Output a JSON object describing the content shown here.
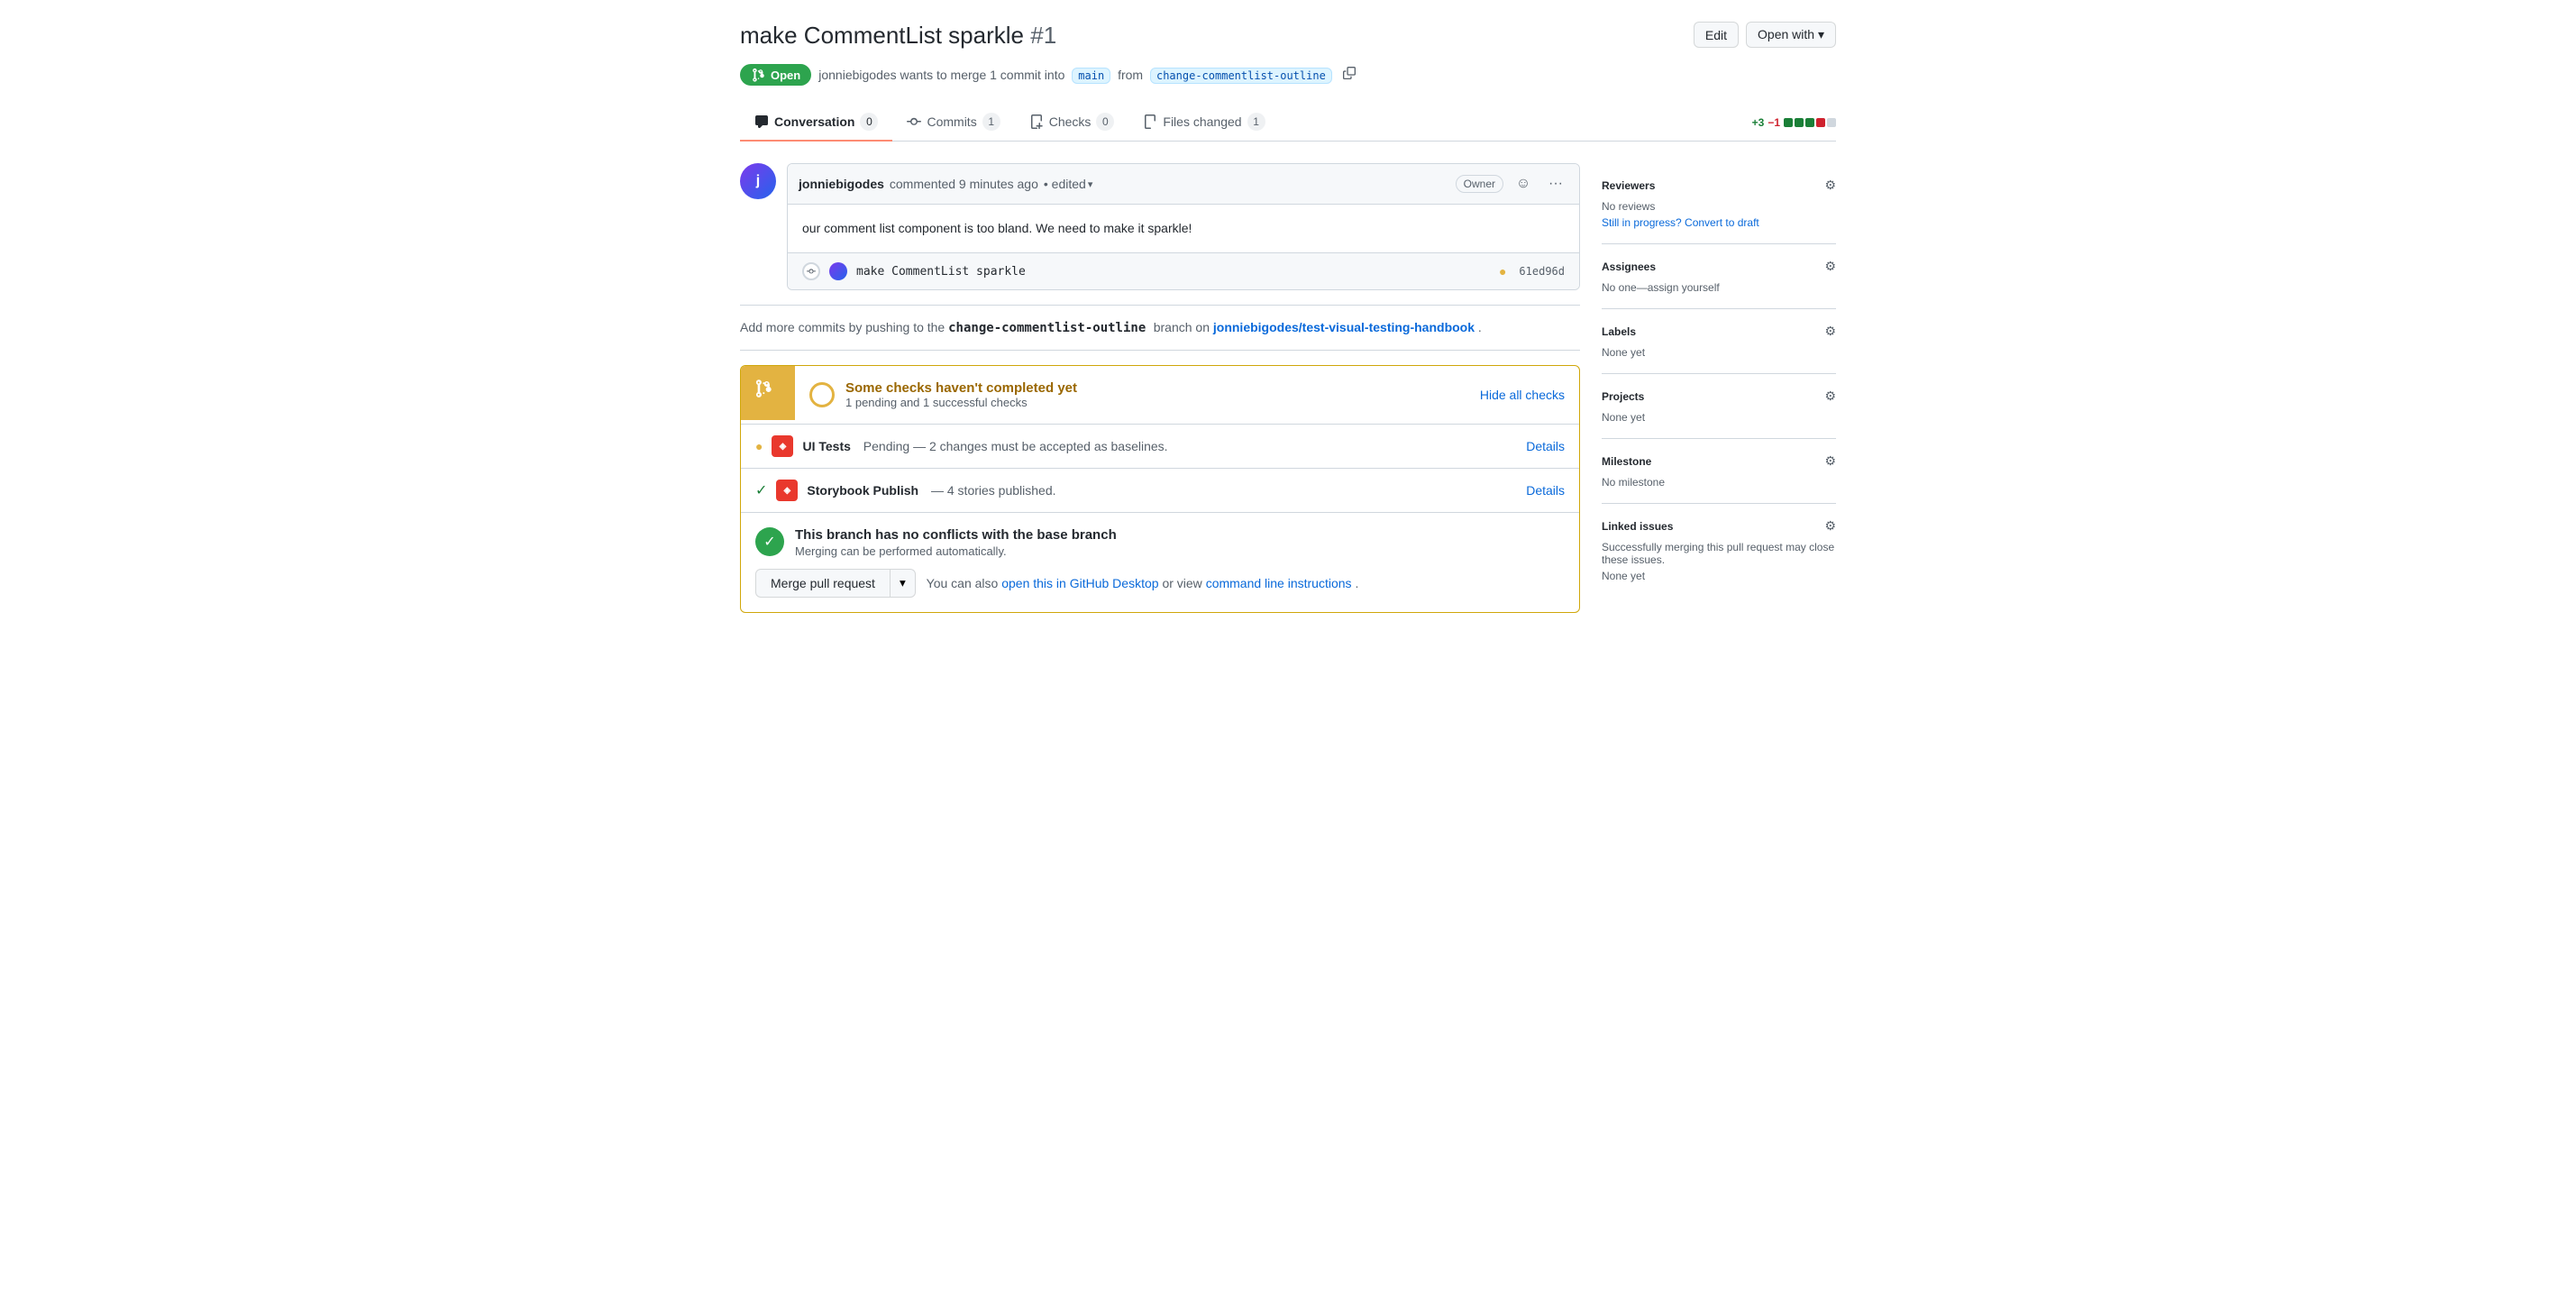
{
  "header": {
    "title": "make CommentList sparkle",
    "pr_number": "#1",
    "edit_label": "Edit",
    "open_with_label": "Open with ▾"
  },
  "status": {
    "badge": "Open",
    "description": "jonniebigodes wants to merge 1 commit into",
    "base_branch": "main",
    "from_text": "from",
    "head_branch": "change-commentlist-outline"
  },
  "tabs": {
    "conversation": {
      "label": "Conversation",
      "count": "0"
    },
    "commits": {
      "label": "Commits",
      "count": "1"
    },
    "checks": {
      "label": "Checks",
      "count": "0"
    },
    "files_changed": {
      "label": "Files changed",
      "count": "1"
    }
  },
  "diff_stats": {
    "additions": "+3",
    "deletions": "−1"
  },
  "comment": {
    "author": "jonniebigodes",
    "time": "commented 9 minutes ago",
    "edited": "• edited",
    "owner_badge": "Owner",
    "body": "our comment list component is too bland. We need to make it sparkle!"
  },
  "commit": {
    "name": "make CommentList sparkle",
    "sha": "61ed96d"
  },
  "push_notice": {
    "text_before": "Add more commits by pushing to the",
    "branch": "change-commentlist-outline",
    "text_middle": "branch on",
    "repo": "jonniebigodes/test-visual-testing-handbook",
    "text_after": "."
  },
  "checks": {
    "title": "Some checks haven't completed yet",
    "subtitle": "1 pending and 1 successful checks",
    "hide_label": "Hide all checks",
    "items": [
      {
        "name": "UI Tests",
        "status_dot": "yellow",
        "description": "Pending — 2 changes must be accepted as baselines.",
        "link": "Details"
      },
      {
        "name": "Storybook Publish",
        "status_dot": "green",
        "description": "— 4 stories published.",
        "link": "Details"
      }
    ]
  },
  "merge": {
    "title": "This branch has no conflicts with the base branch",
    "subtitle": "Merging can be performed automatically.",
    "button": "Merge pull request",
    "also_text": "You can also",
    "desktop_link": "open this in GitHub Desktop",
    "or_text": "or view",
    "cli_link": "command line instructions",
    "period": "."
  },
  "sidebar": {
    "reviewers": {
      "title": "Reviewers",
      "no_reviews": "No reviews",
      "convert": "Still in progress? Convert to draft"
    },
    "assignees": {
      "title": "Assignees",
      "none": "No one—assign yourself"
    },
    "labels": {
      "title": "Labels",
      "none": "None yet"
    },
    "projects": {
      "title": "Projects",
      "none": "None yet"
    },
    "milestone": {
      "title": "Milestone",
      "none": "No milestone"
    },
    "linked_issues": {
      "title": "Linked issues",
      "description": "Successfully merging this pull request may close these issues.",
      "none": "None yet"
    }
  }
}
